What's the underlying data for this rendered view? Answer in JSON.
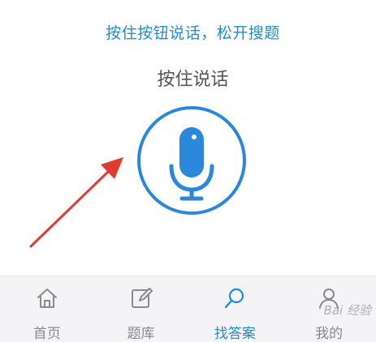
{
  "colors": {
    "accent": "#1a8ed6",
    "mic": "#2b87d9",
    "arrow": "#e23a2e",
    "tab_inactive": "#8a8a8a",
    "tab_active": "#1a8ed6",
    "tab_bg": "#f4f4f6"
  },
  "prompt": {
    "hint": "按住按钮说话，松开搜题",
    "title": "按住说话"
  },
  "mic_button": {
    "icon": "microphone-icon"
  },
  "tabbar": {
    "tabs": [
      {
        "label": "首页",
        "icon": "home-icon",
        "active": false
      },
      {
        "label": "题库",
        "icon": "edit-icon",
        "active": false
      },
      {
        "label": "找答案",
        "icon": "search-icon",
        "active": true
      },
      {
        "label": "我的",
        "icon": "user-icon",
        "active": false
      }
    ]
  },
  "watermark": {
    "text": "Bai 经验"
  }
}
